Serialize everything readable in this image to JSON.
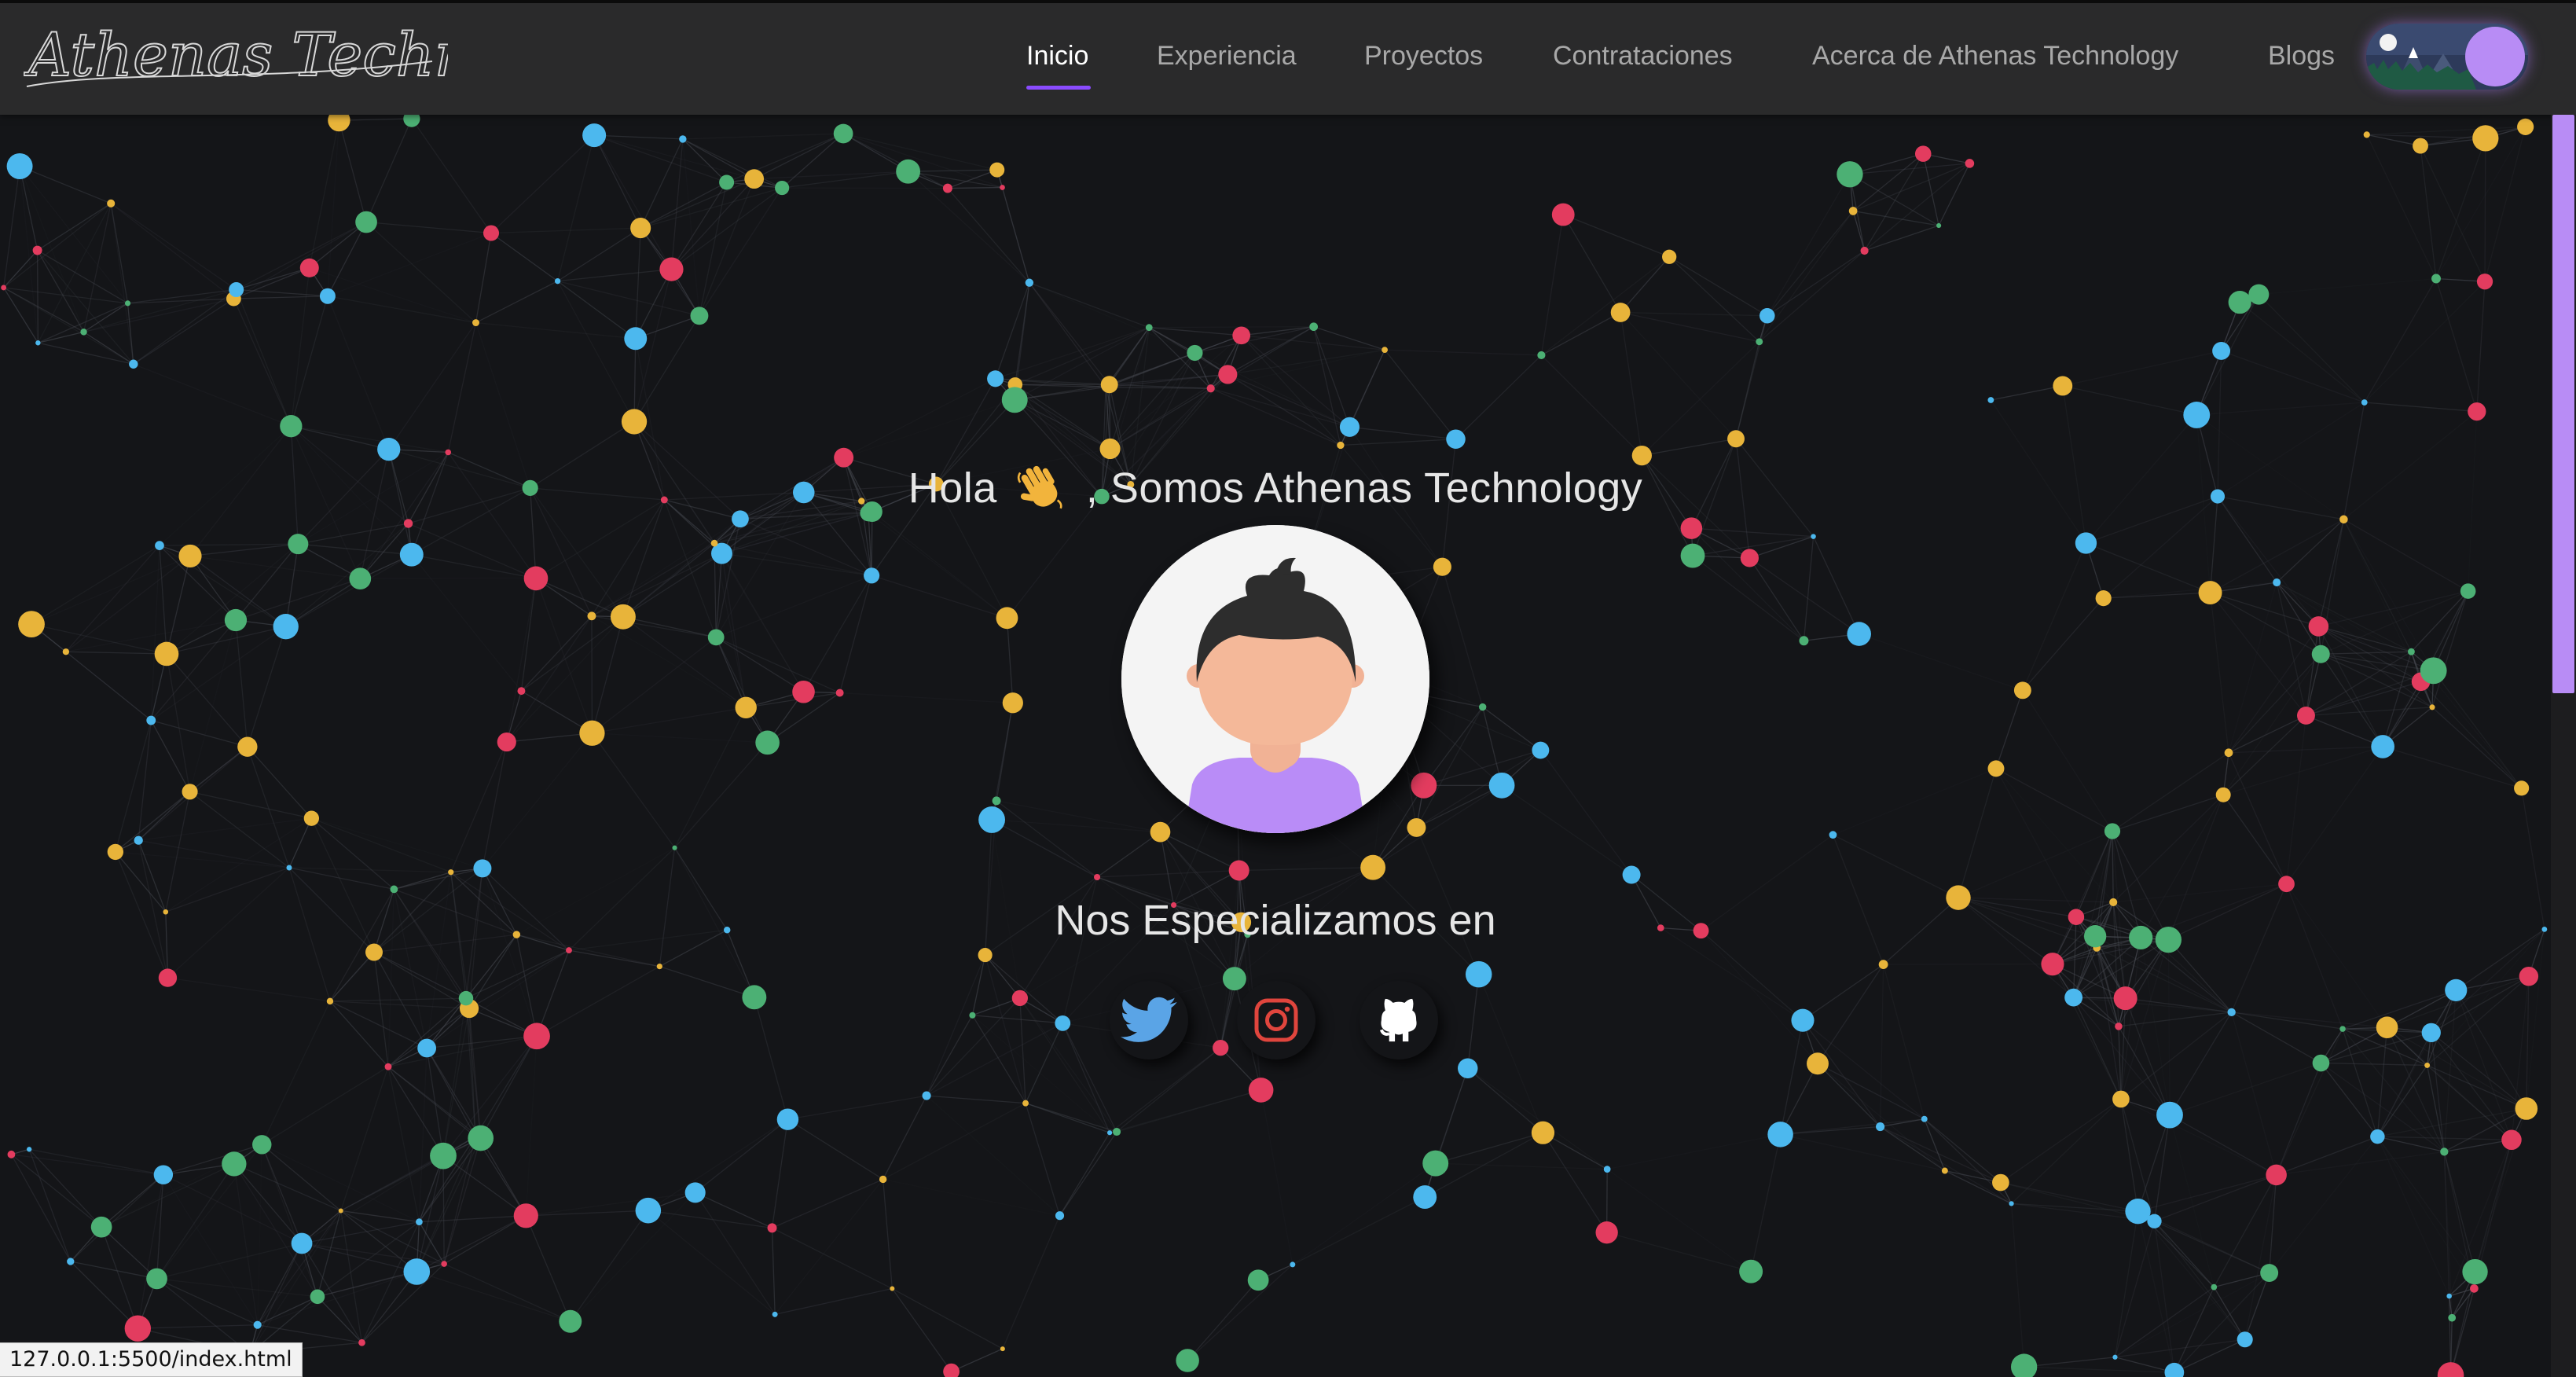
{
  "brand": {
    "logo_text": "Athenas Technology"
  },
  "nav": {
    "items": [
      {
        "label": "Inicio",
        "active": true
      },
      {
        "label": "Experiencia",
        "active": false
      },
      {
        "label": "Proyectos",
        "active": false
      },
      {
        "label": "Contrataciones",
        "active": false
      },
      {
        "label": "Acerca de Athenas Technology",
        "active": false
      },
      {
        "label": "Blogs",
        "active": false
      }
    ],
    "accent_color": "#8a4bff"
  },
  "theme_toggle": {
    "icon": "night-landscape-toggle-icon",
    "knob_color": "#b88cf5"
  },
  "hero": {
    "greeting_before": "Hola",
    "greeting_icon": "waving-hand-icon",
    "greeting_after": ", Somos Athenas Technology",
    "specialize_text": "Nos Especializamos en",
    "avatar_icon": "person-avatar-icon"
  },
  "social_links": [
    {
      "icon": "twitter-icon",
      "color": "#5aa4e6"
    },
    {
      "icon": "instagram-icon",
      "color": "#e0453d"
    },
    {
      "icon": "github-icon",
      "color": "#ffffff"
    }
  ],
  "network_colors": [
    "#4cb8ee",
    "#e33c5f",
    "#e8b43a",
    "#4cb074"
  ],
  "status_bar": {
    "url": "127.0.0.1:5500/index.html"
  }
}
